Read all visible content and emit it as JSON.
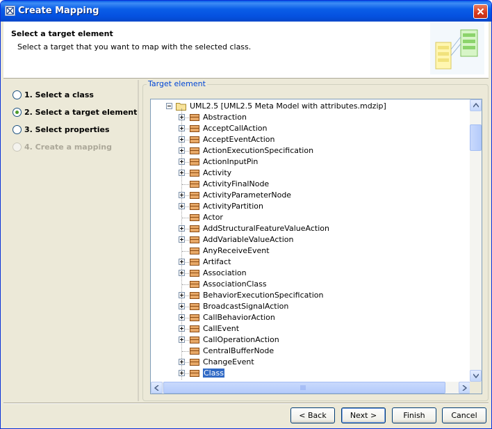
{
  "window": {
    "title": "Create Mapping",
    "close_icon": "close-icon"
  },
  "header": {
    "title": "Select a target element",
    "subtitle": "Select a target that you want to map with the selected class."
  },
  "steps": [
    {
      "label": "1. Select a class",
      "state": "normal"
    },
    {
      "label": "2. Select a target element",
      "state": "selected"
    },
    {
      "label": "3. Select properties",
      "state": "normal"
    },
    {
      "label": "4. Create a mapping",
      "state": "disabled"
    }
  ],
  "target": {
    "group_label": "Target element",
    "root": "UML2.5 [UML2.5 Meta Model with attributes.mdzip]",
    "items": [
      {
        "label": "Abstraction",
        "expandable": true
      },
      {
        "label": "AcceptCallAction",
        "expandable": true
      },
      {
        "label": "AcceptEventAction",
        "expandable": true
      },
      {
        "label": "ActionExecutionSpecification",
        "expandable": true
      },
      {
        "label": "ActionInputPin",
        "expandable": true
      },
      {
        "label": "Activity",
        "expandable": true
      },
      {
        "label": "ActivityFinalNode",
        "expandable": false
      },
      {
        "label": "ActivityParameterNode",
        "expandable": true
      },
      {
        "label": "ActivityPartition",
        "expandable": true
      },
      {
        "label": "Actor",
        "expandable": false
      },
      {
        "label": "AddStructuralFeatureValueAction",
        "expandable": true
      },
      {
        "label": "AddVariableValueAction",
        "expandable": true
      },
      {
        "label": "AnyReceiveEvent",
        "expandable": false
      },
      {
        "label": "Artifact",
        "expandable": true
      },
      {
        "label": "Association",
        "expandable": true
      },
      {
        "label": "AssociationClass",
        "expandable": false
      },
      {
        "label": "BehaviorExecutionSpecification",
        "expandable": true
      },
      {
        "label": "BroadcastSignalAction",
        "expandable": true
      },
      {
        "label": "CallBehaviorAction",
        "expandable": true
      },
      {
        "label": "CallEvent",
        "expandable": true
      },
      {
        "label": "CallOperationAction",
        "expandable": true
      },
      {
        "label": "CentralBufferNode",
        "expandable": false
      },
      {
        "label": "ChangeEvent",
        "expandable": true
      },
      {
        "label": "Class",
        "expandable": true,
        "selected": true
      }
    ]
  },
  "buttons": {
    "back": "< Back",
    "next": "Next >",
    "finish": "Finish",
    "cancel": "Cancel"
  },
  "colors": {
    "titlebar": "#0a5ee8",
    "selection": "#316ac5",
    "group_label": "#0046d5"
  }
}
